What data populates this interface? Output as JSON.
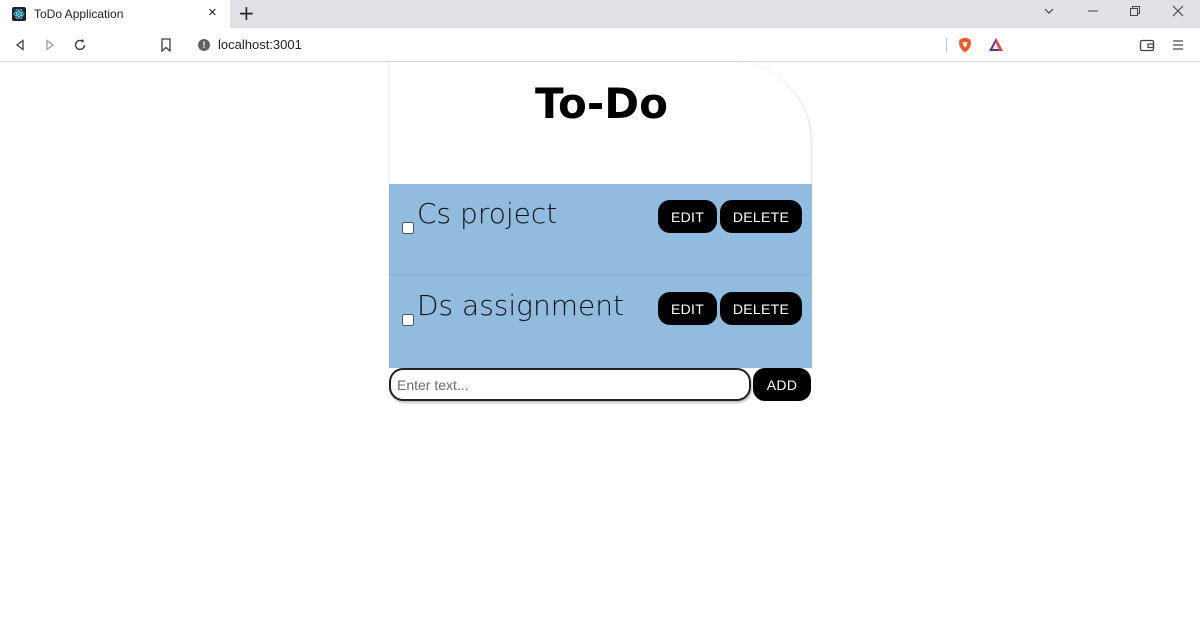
{
  "browser": {
    "tab_title": "ToDo Application",
    "tab_close": "×",
    "new_tab": "+",
    "url": "localhost:3001",
    "controls": {
      "minimize": "─",
      "restore": "❐",
      "close": "✕",
      "tab_search": "⌄"
    }
  },
  "app": {
    "title": "To-Do",
    "todos": [
      {
        "text": "Cs project",
        "checked": false,
        "edit_label": "EDIT",
        "delete_label": "DELETE"
      },
      {
        "text": "Ds assignment",
        "checked": false,
        "edit_label": "EDIT",
        "delete_label": "DELETE"
      }
    ],
    "new_todo": {
      "placeholder": "Enter text...",
      "value": "",
      "add_label": "ADD"
    }
  },
  "colors": {
    "list_background": "#91bbdf",
    "button_background": "#000000",
    "button_text": "#ffffff"
  }
}
